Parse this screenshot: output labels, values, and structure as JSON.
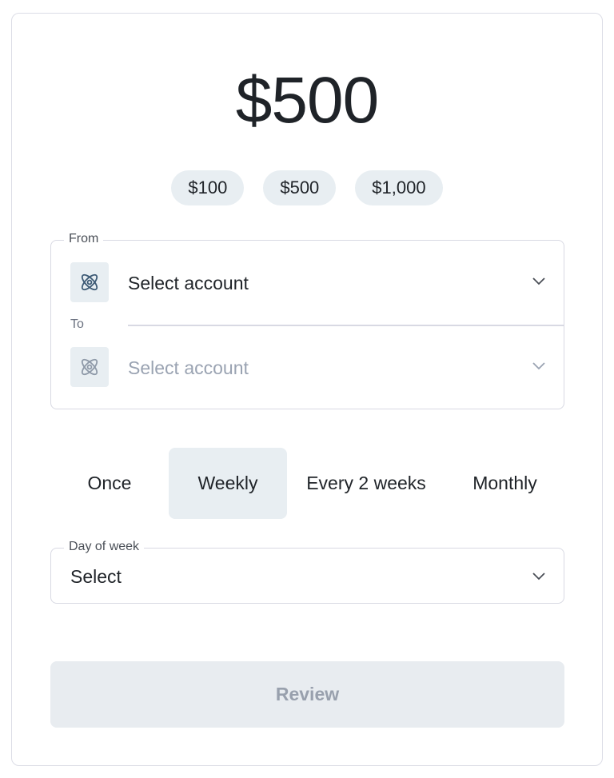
{
  "amount": "$500",
  "presets": [
    "$100",
    "$500",
    "$1,000"
  ],
  "accounts": {
    "from_label": "From",
    "from_placeholder": "Select account",
    "to_label": "To",
    "to_placeholder": "Select account"
  },
  "frequency": {
    "options": [
      "Once",
      "Weekly",
      "Every 2 weeks",
      "Monthly"
    ],
    "selected": "Weekly"
  },
  "day_of_week": {
    "label": "Day of week",
    "value": "Select"
  },
  "review_label": "Review",
  "colors": {
    "chip_bg": "#e8eef2",
    "border": "#d8d9e3",
    "placeholder": "#9aa3b2",
    "disabled_button_bg": "#e8ecf0",
    "disabled_button_text": "#98a0ad",
    "icon_active": "#3d5a75",
    "icon_muted": "#8e99a8"
  },
  "icons": {
    "account": "linked-rings-icon",
    "dropdown": "chevron-down-icon"
  }
}
